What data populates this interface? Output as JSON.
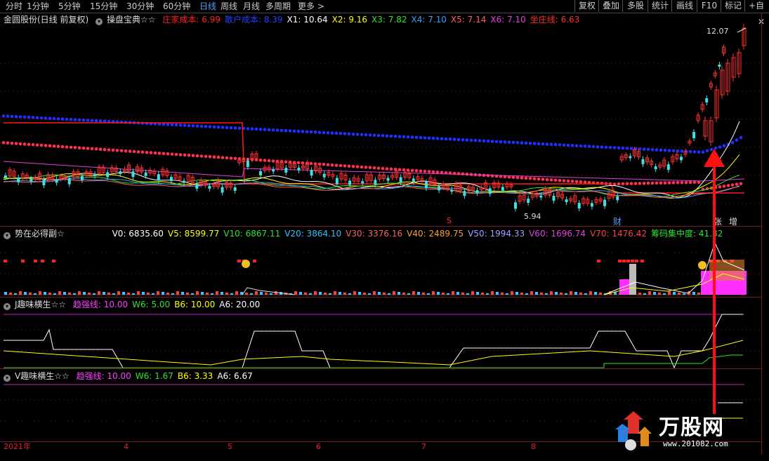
{
  "toolbar": {
    "tabs": [
      "分时",
      "1分钟",
      "5分钟",
      "15分钟",
      "30分钟",
      "60分钟",
      "日线",
      "周线",
      "月线",
      "多周期",
      "更多 >"
    ],
    "active_tab": "日线",
    "buttons": [
      "复权",
      "叠加",
      "多股",
      "统计",
      "画线",
      "F10",
      "标记",
      "+自"
    ],
    "close": "✕"
  },
  "main": {
    "title": "金圆股份(日线 前复权)",
    "indicator": "操盘宝典☆☆",
    "values": [
      {
        "label": "庄家成本: ",
        "value": "6.99",
        "color": "#ff2020"
      },
      {
        "label": "散户成本: ",
        "value": "8.39",
        "color": "#2040ff"
      },
      {
        "label": "X1: ",
        "value": "10.64",
        "color": "#ffffff"
      },
      {
        "label": "X2: ",
        "value": "9.16",
        "color": "#ffff00"
      },
      {
        "label": "X3: ",
        "value": "7.82",
        "color": "#30e030"
      },
      {
        "label": "X4: ",
        "value": "7.10",
        "color": "#30a0ff"
      },
      {
        "label": "X5: ",
        "value": "7.14",
        "color": "#ff6060"
      },
      {
        "label": "X6: ",
        "value": "7.10",
        "color": "#e040e0"
      },
      {
        "label": "坐庄线: ",
        "value": "6.63",
        "color": "#ff3030"
      }
    ],
    "high_label": "12.07",
    "low_label": "5.94",
    "markers": {
      "s": "S",
      "cai": "财",
      "zhang": "张",
      "zeng": "增"
    }
  },
  "panel2": {
    "title": "势在必得副☆",
    "values": [
      {
        "label": "V0: ",
        "value": "6835.60",
        "color": "#ffffff"
      },
      {
        "label": "V5: ",
        "value": "8599.77",
        "color": "#ffff00"
      },
      {
        "label": "V10: ",
        "value": "6867.11",
        "color": "#30e030"
      },
      {
        "label": "V20: ",
        "value": "3864.10",
        "color": "#30c0ff"
      },
      {
        "label": "V30: ",
        "value": "3376.16",
        "color": "#ff6060"
      },
      {
        "label": "V40: ",
        "value": "2489.75",
        "color": "#ff9a30"
      },
      {
        "label": "V50: ",
        "value": "1994.33",
        "color": "#a0a0ff"
      },
      {
        "label": "V60: ",
        "value": "1696.74",
        "color": "#e040e0"
      },
      {
        "label": "V70: ",
        "value": "1476.42",
        "color": "#ff4040"
      },
      {
        "label": "筹码集中度: ",
        "value": "41.82",
        "color": "#30e030"
      }
    ]
  },
  "panel3": {
    "title": "J趣味横生☆☆",
    "values": [
      {
        "label": "趋强线: ",
        "value": "10.00",
        "color": "#ff40ff"
      },
      {
        "label": "W6: ",
        "value": "5.00",
        "color": "#30e030"
      },
      {
        "label": "B6: ",
        "value": "10.00",
        "color": "#ffff00"
      },
      {
        "label": "A6: ",
        "value": "20.00",
        "color": "#ffffff"
      }
    ]
  },
  "panel4": {
    "title": "V趣味横生☆☆",
    "values": [
      {
        "label": "趋强线: ",
        "value": "10.00",
        "color": "#ff40ff"
      },
      {
        "label": "W6: ",
        "value": "1.67",
        "color": "#30e030"
      },
      {
        "label": "B6: ",
        "value": "3.33",
        "color": "#ffff00"
      },
      {
        "label": "A6: ",
        "value": "6.67",
        "color": "#ffffff"
      }
    ]
  },
  "xaxis": {
    "labels": [
      "2021年",
      "4",
      "5",
      "6",
      "7",
      "8"
    ]
  },
  "logo": {
    "name": "万股网",
    "url": "www.201082.com"
  }
}
